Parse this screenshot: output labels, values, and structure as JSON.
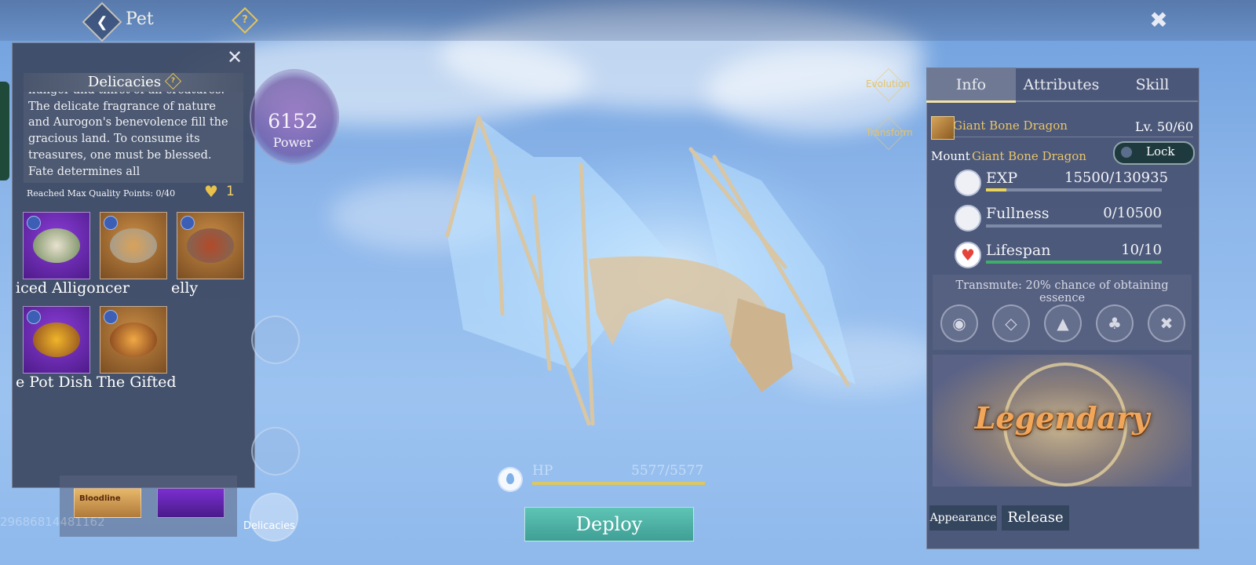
{
  "header": {
    "title": "Pet"
  },
  "delicacies": {
    "title": "Delicacies",
    "description": "hunger and thirst of all creatures. The delicate fragrance of nature and Aurogon's benevolence fill the gracious land. To consume its treasures, one must be blessed. Fate determines all",
    "max_quality": "Reached Max Quality Points: 0/40",
    "heart_count": "1",
    "items": [
      {
        "name": "iced Alligoncer"
      },
      {
        "name": ""
      },
      {
        "name": "elly"
      },
      {
        "name": "e Pot Dish"
      },
      {
        "name": "The Gifted"
      }
    ],
    "bloodline_label": "Bloodline",
    "uid": "29686814481162"
  },
  "power": {
    "value": "6152",
    "label": "Power"
  },
  "side_buttons": {
    "delicacies_label": "Delicacies"
  },
  "evolution": {
    "evolution_label": "Evolution",
    "transform_label": "Transform"
  },
  "hp": {
    "label": "HP",
    "value": "5577/5577",
    "fraction": 1.0
  },
  "deploy_label": "Deploy",
  "info_panel": {
    "tabs": [
      "Info",
      "Attributes",
      "Skill"
    ],
    "pet_name": "Giant Bone Dragon",
    "level": "Lv. 50/60",
    "mount_label": "Mount",
    "mount_value": "Giant Bone Dragon",
    "lock_label": "Lock",
    "stats": [
      {
        "label": "EXP",
        "value": "15500/130935",
        "fraction": 0.118,
        "color": "#e9d35a"
      },
      {
        "label": "Fullness",
        "value": "0/10500",
        "fraction": 0.0,
        "color": "#e9d35a"
      },
      {
        "label": "Lifespan",
        "value": "10/10",
        "fraction": 1.0,
        "color": "#3fae6a"
      }
    ],
    "transmute": "Transmute: 20% chance of obtaining essence",
    "essence_icons": [
      "eye-icon",
      "diamond-icon",
      "flame-icon",
      "trefoil-icon",
      "cross-icon"
    ],
    "rarity": "Legendary",
    "appearance_label": "Appearance",
    "release_label": "Release"
  }
}
